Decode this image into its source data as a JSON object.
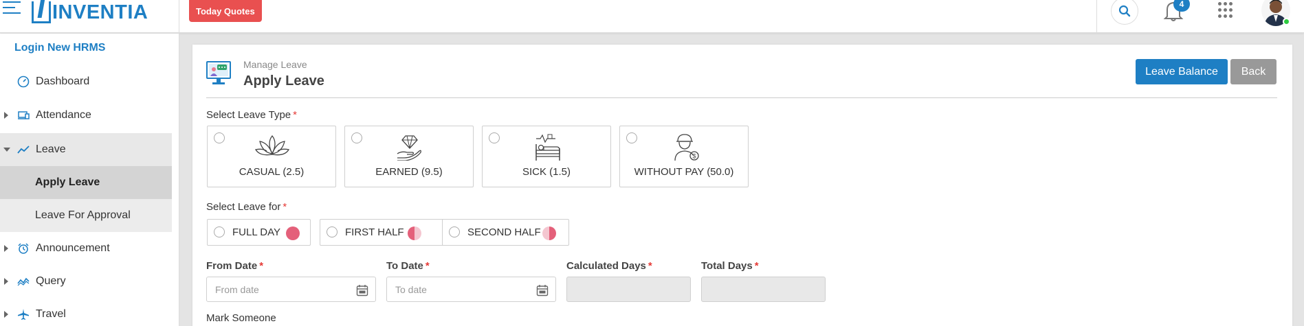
{
  "header": {
    "logo_text": "INVENTIA",
    "today_quotes_label": "Today Quotes",
    "notification_count": "4"
  },
  "sidebar": {
    "login_link": "Login New HRMS",
    "items": [
      {
        "label": "Dashboard"
      },
      {
        "label": "Attendance"
      },
      {
        "label": "Leave"
      },
      {
        "label": "Announcement"
      },
      {
        "label": "Query"
      },
      {
        "label": "Travel"
      }
    ],
    "leave_sub": [
      {
        "label": "Apply Leave"
      },
      {
        "label": "Leave For Approval"
      }
    ]
  },
  "page": {
    "breadcrumb": "Manage Leave",
    "title": "Apply Leave",
    "leave_balance_label": "Leave Balance",
    "back_label": "Back"
  },
  "form": {
    "leave_type_label": "Select Leave Type",
    "leave_types": [
      {
        "label": "CASUAL (2.5)",
        "icon": "lotus-icon"
      },
      {
        "label": "EARNED (9.5)",
        "icon": "diamond-hand-icon"
      },
      {
        "label": "SICK (1.5)",
        "icon": "hospital-bed-icon"
      },
      {
        "label": "WITHOUT PAY (50.0)",
        "icon": "worker-money-icon"
      }
    ],
    "leave_for_label": "Select Leave for",
    "leave_for_options": [
      {
        "label": "FULL DAY"
      },
      {
        "label": "FIRST HALF"
      },
      {
        "label": "SECOND HALF"
      }
    ],
    "from_date_label": "From Date",
    "from_date_placeholder": "From date",
    "to_date_label": "To Date",
    "to_date_placeholder": "To date",
    "calculated_days_label": "Calculated Days",
    "total_days_label": "Total Days",
    "mark_someone_label": "Mark Someone",
    "required_mark": "*"
  },
  "colors": {
    "brand_blue": "#1e7fc4",
    "quote_red": "#e95050",
    "dot_pink": "#e4607a",
    "back_gray": "#999999"
  }
}
